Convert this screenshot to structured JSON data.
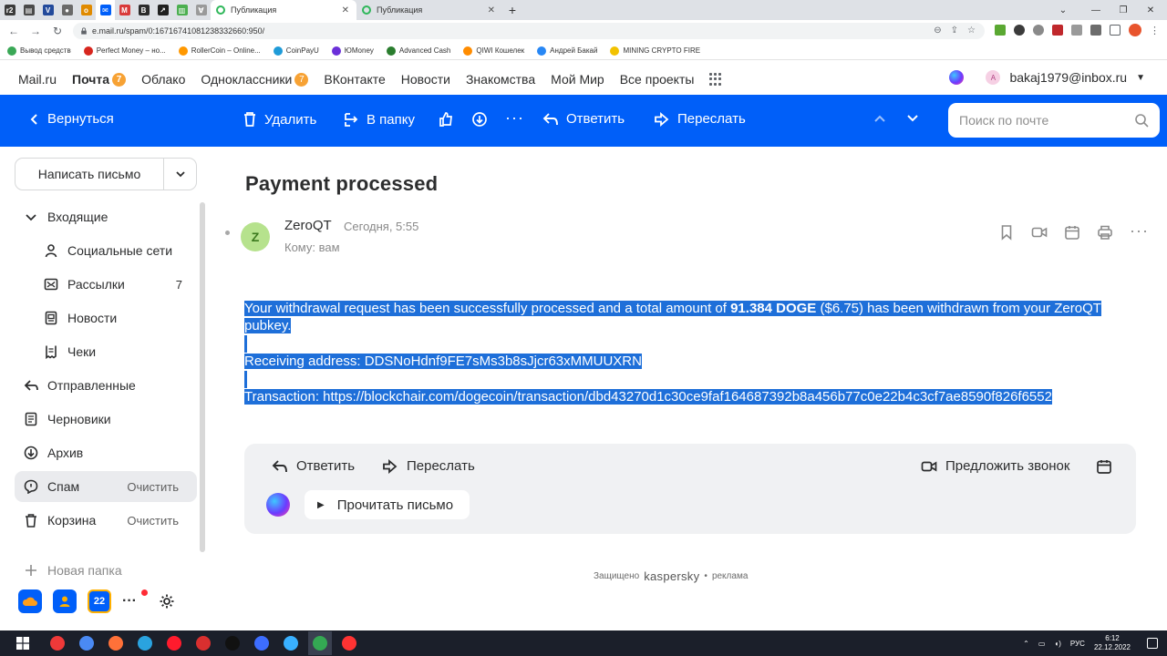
{
  "browser": {
    "pinned_tabs": [
      {
        "icon": "r2-favicon",
        "color": "#3b3b3b",
        "glyph": "r2"
      },
      {
        "icon": "newspaper-favicon",
        "color": "#4a4a4a",
        "glyph": "▤"
      },
      {
        "icon": "shield-favicon",
        "color": "#234a9b",
        "glyph": "V"
      },
      {
        "icon": "circle-favicon",
        "color": "#6a6a6a",
        "glyph": "●"
      },
      {
        "icon": "coin-favicon",
        "color": "#e08a00",
        "glyph": "o"
      },
      {
        "icon": "mail-favicon",
        "color": "#005ff9",
        "glyph": "✉"
      },
      {
        "icon": "m-favicon",
        "color": "#d93a3a",
        "glyph": "M"
      },
      {
        "icon": "b-favicon",
        "color": "#2b2b2b",
        "glyph": "B"
      },
      {
        "icon": "arrow-favicon",
        "color": "#202020",
        "glyph": "↗"
      },
      {
        "icon": "chart-favicon",
        "color": "#4caf50",
        "glyph": "▥"
      },
      {
        "icon": "v-favicon",
        "color": "#9a9a9a",
        "glyph": "∀"
      }
    ],
    "tabs": [
      {
        "title": "Публикация",
        "active": true
      },
      {
        "title": "Публикация",
        "active": false
      }
    ],
    "url": "e.mail.ru/spam/0:16716741081238332660:950/",
    "bookmarks": [
      {
        "label": "Вывод средств",
        "color": "#3aa856"
      },
      {
        "label": "Perfect Money – но...",
        "color": "#d7261e"
      },
      {
        "label": "RollerCoin – Online...",
        "color": "#ff9800"
      },
      {
        "label": "CoinPayU",
        "color": "#1f9bd8"
      },
      {
        "label": "ЮMoney",
        "color": "#6b2fd9"
      },
      {
        "label": "Advanced Cash",
        "color": "#2a7d2e"
      },
      {
        "label": "QIWI Кошелек",
        "color": "#ff8c00"
      },
      {
        "label": "Андрей Бакай",
        "color": "#2787f5"
      },
      {
        "label": "MINING CRYPTO FIRE",
        "color": "#f2c200"
      }
    ]
  },
  "portal": {
    "links": [
      {
        "label": "Mail.ru",
        "bold": false,
        "badge": ""
      },
      {
        "label": "Почта",
        "bold": true,
        "badge": "7"
      },
      {
        "label": "Облако",
        "bold": false,
        "badge": ""
      },
      {
        "label": "Одноклассники",
        "bold": false,
        "badge": "7"
      },
      {
        "label": "ВКонтакте",
        "bold": false,
        "badge": ""
      },
      {
        "label": "Новости",
        "bold": false,
        "badge": ""
      },
      {
        "label": "Знакомства",
        "bold": false,
        "badge": ""
      },
      {
        "label": "Мой Мир",
        "bold": false,
        "badge": ""
      },
      {
        "label": "Все проекты",
        "bold": false,
        "badge": ""
      }
    ],
    "user_initial": "A",
    "user_email": "bakaj1979@inbox.ru"
  },
  "mailbar": {
    "back": "Вернуться",
    "delete": "Удалить",
    "to_folder": "В папку",
    "reply": "Ответить",
    "forward": "Переслать",
    "search_placeholder": "Поиск по почте",
    "accent": "#005ff9"
  },
  "sidebar": {
    "compose": "Написать письмо",
    "folders": [
      {
        "label": "Входящие",
        "icon": "chevron-down-icon",
        "sub": false,
        "count": "",
        "action": "",
        "active": false
      },
      {
        "label": "Социальные сети",
        "icon": "people-icon",
        "sub": true,
        "count": "",
        "action": "",
        "active": false
      },
      {
        "label": "Рассылки",
        "icon": "newsletter-icon",
        "sub": true,
        "count": "7",
        "action": "",
        "active": false
      },
      {
        "label": "Новости",
        "icon": "news-icon",
        "sub": true,
        "count": "",
        "action": "",
        "active": false
      },
      {
        "label": "Чеки",
        "icon": "receipt-icon",
        "sub": true,
        "count": "",
        "action": "",
        "active": false
      },
      {
        "label": "Отправленные",
        "icon": "sent-icon",
        "sub": false,
        "count": "",
        "action": "",
        "active": false
      },
      {
        "label": "Черновики",
        "icon": "draft-icon",
        "sub": false,
        "count": "",
        "action": "",
        "active": false
      },
      {
        "label": "Архив",
        "icon": "archive-icon",
        "sub": false,
        "count": "",
        "action": "",
        "active": false
      },
      {
        "label": "Спам",
        "icon": "spam-icon",
        "sub": false,
        "count": "",
        "action": "Очистить",
        "active": true
      },
      {
        "label": "Корзина",
        "icon": "trash-icon",
        "sub": false,
        "count": "",
        "action": "Очистить",
        "active": false
      },
      {
        "label": "Новая папка",
        "icon": "plus-icon",
        "sub": false,
        "count": "",
        "action": "",
        "active": false
      }
    ],
    "calendar_day": "22"
  },
  "message": {
    "subject": "Payment processed",
    "sender_initial": "Z",
    "sender": "ZeroQT",
    "date": "Сегодня, 5:55",
    "to": "Кому: вам",
    "body_intro": "Your withdrawal request has been successfully processed and a total amount of ",
    "body_amount": "91.384 DOGE",
    "body_rest": " ($6.75) has been withdrawn from your ZeroQT pubkey.",
    "receiving_address": "Receiving address: DDSNoHdnf9FE7sMs3b8sJjcr63xMMUUXRN",
    "transaction": "Transaction: https://blockchair.com/dogecoin/transaction/dbd43270d1c30ce9faf164687392b8a456b77c0e22b4c3cf7ae8590f826f6552"
  },
  "reply_panel": {
    "reply": "Ответить",
    "forward": "Переслать",
    "suggest_call": "Предложить звонок",
    "read_aloud": "Прочитать письмо"
  },
  "footer": {
    "protected": "Защищено",
    "brand": "kaspersky",
    "sep": "•",
    "ad": "реклама"
  },
  "taskbar": {
    "apps": [
      {
        "icon": "vivaldi-icon",
        "color": "#ef3939"
      },
      {
        "icon": "chrome-blue-icon",
        "color": "#4a8af4"
      },
      {
        "icon": "firefox-icon",
        "color": "#ff7139"
      },
      {
        "icon": "telegram-icon",
        "color": "#2aa3df"
      },
      {
        "icon": "opera-icon",
        "color": "#ff1b2d"
      },
      {
        "icon": "compass-icon",
        "color": "#d92f2f"
      },
      {
        "icon": "tiktok-icon",
        "color": "#111111"
      },
      {
        "icon": "network-icon",
        "color": "#3d6dff"
      },
      {
        "icon": "wings-icon",
        "color": "#39b0ff"
      },
      {
        "icon": "chrome-icon",
        "color": "#34a853"
      },
      {
        "icon": "yandex-icon",
        "color": "#ff3333"
      }
    ],
    "lang": "РУС",
    "time": "6:12",
    "date": "22.12.2022"
  }
}
